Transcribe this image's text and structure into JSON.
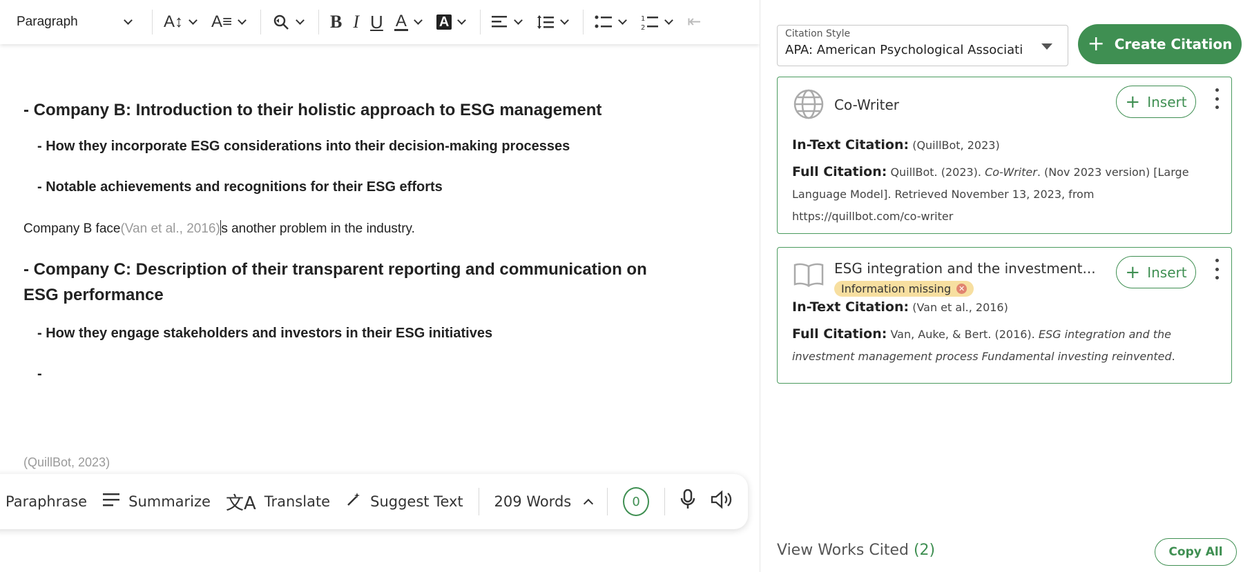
{
  "toolbar": {
    "paragraph_style": "Paragraph",
    "icons": [
      "text-size-icon",
      "font-style-icon",
      "find-replace-icon",
      "bold-icon",
      "italic-icon",
      "underline-icon",
      "text-color-icon",
      "highlight-color-icon",
      "align-icon",
      "line-spacing-icon",
      "bullet-list-icon",
      "numbered-list-icon",
      "outdent-icon"
    ]
  },
  "document": {
    "heading_b": "- Company B: Introduction to their holistic approach to ESG management",
    "sub_b1": "- How they incorporate ESG considerations into their decision-making processes",
    "sub_b2": "- Notable achievements and recognitions for their ESG efforts",
    "para_before": "Company B face",
    "para_citation": "(Van et al., 2016)",
    "para_after": "s another problem in the industry.",
    "heading_c": "- Company C: Description of their transparent reporting and communication on ESG performance",
    "sub_c1": "- How they engage stakeholders and investors in their ESG initiatives",
    "sub_c2": "-",
    "footer_citation": "(QuillBot, 2023)"
  },
  "bottom_bar": {
    "paraphrase": "Paraphrase",
    "summarize": "Summarize",
    "translate": "Translate",
    "suggest_text": "Suggest Text",
    "word_count": "209 Words",
    "issues_count": "0"
  },
  "citation_panel": {
    "style_label": "Citation Style",
    "style_value": "APA: American Psychological Associati...",
    "create_button": "Create Citation",
    "cards": [
      {
        "title": "Co-Writer",
        "icon": "globe-icon",
        "insert_label": "Insert",
        "in_text_label": "In-Text Citation:",
        "in_text_value": "(QuillBot, 2023)",
        "full_label": "Full Citation:",
        "full_pre": "QuillBot. (2023). ",
        "full_italic": "Co-Writer",
        "full_post": ". (Nov 2023 version) [Large Language Model]. Retrieved November 13, 2023, from https://quillbot.com/co-writer"
      },
      {
        "title": "ESG integration and the investment...",
        "icon": "book-icon",
        "badge": "Information missing",
        "insert_label": "Insert",
        "in_text_label": "In-Text Citation:",
        "in_text_value": "(Van et al., 2016)",
        "full_label": "Full Citation:",
        "full_pre": "Van, Auke, & Bert. (2016). ",
        "full_italic": "ESG integration and the investment management process Fundamental investing reinvented",
        "full_post": "."
      }
    ],
    "works_cited_label": "View Works Cited",
    "works_cited_count": "(2)",
    "copy_all": "Copy All"
  },
  "colors": {
    "accent": "#3f8f52",
    "badge": "#f7dfa0",
    "ghost_text": "#9a9a9a"
  }
}
